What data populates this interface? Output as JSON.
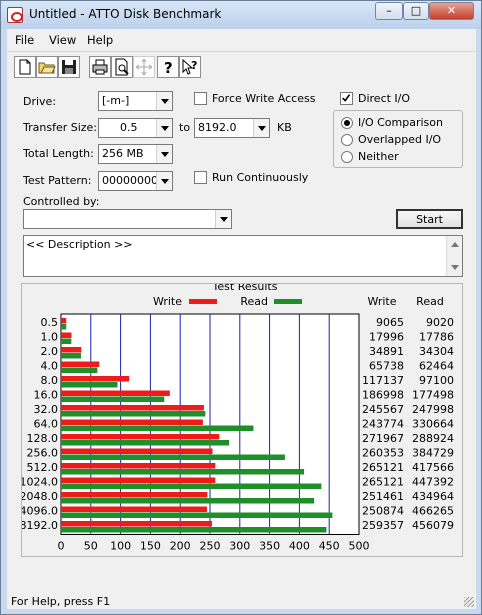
{
  "window": {
    "title": "Untitled - ATTO Disk Benchmark",
    "min": "–",
    "max": "□",
    "close": "✕"
  },
  "menu": [
    "File",
    "View",
    "Help"
  ],
  "toolbar": [
    "new-icon",
    "open-icon",
    "save-icon",
    "print-icon",
    "print-preview-icon",
    "move-icon",
    "help-icon",
    "context-help-icon"
  ],
  "settings": {
    "drive_label": "Drive:",
    "drive_value": "[-m-]",
    "transfer_size_label": "Transfer Size:",
    "transfer_from": "0.5",
    "to_label": "to",
    "transfer_to": "8192.0",
    "transfer_unit": "KB",
    "total_length_label": "Total Length:",
    "total_length_value": "256 MB",
    "test_pattern_label": "Test Pattern:",
    "test_pattern_value": "00000000",
    "force_write_label": "Force Write Access",
    "run_continuously_label": "Run Continuously",
    "direct_io_label": "Direct I/O",
    "io_options": [
      "I/O Comparison",
      "Overlapped I/O",
      "Neither"
    ],
    "controlled_by_label": "Controlled by:",
    "controlled_by_value": "",
    "start_label": "Start",
    "description": "<< Description >>"
  },
  "results": {
    "title": "Test Results",
    "write_label": "Write",
    "read_label": "Read",
    "col_write": "Write",
    "col_read": "Read"
  },
  "status": "For Help, press F1",
  "colors": {
    "write": "#ee1b1b",
    "read": "#1f8f2a",
    "grid": "#1b1fb3"
  },
  "chart_data": {
    "type": "bar",
    "categories": [
      "0.5",
      "1.0",
      "2.0",
      "4.0",
      "8.0",
      "16.0",
      "32.0",
      "64.0",
      "128.0",
      "256.0",
      "512.0",
      "1024.0",
      "2048.0",
      "4096.0",
      "8192.0"
    ],
    "series": [
      {
        "name": "Write",
        "values": [
          9065,
          17996,
          34891,
          65738,
          117137,
          186998,
          245567,
          243774,
          271967,
          260353,
          265121,
          265121,
          251461,
          250874,
          259357
        ]
      },
      {
        "name": "Read",
        "values": [
          9020,
          17786,
          34304,
          62464,
          97100,
          177498,
          247998,
          330664,
          288924,
          384729,
          417566,
          447392,
          434964,
          466265,
          456079
        ]
      }
    ],
    "xlabel": "Transfer Rate - MB / Sec",
    "xticks": [
      "0",
      "50",
      "100",
      "150",
      "200",
      "250",
      "300",
      "350",
      "400",
      "450",
      "500"
    ],
    "xlim": [
      0,
      500
    ],
    "legend": "top"
  }
}
